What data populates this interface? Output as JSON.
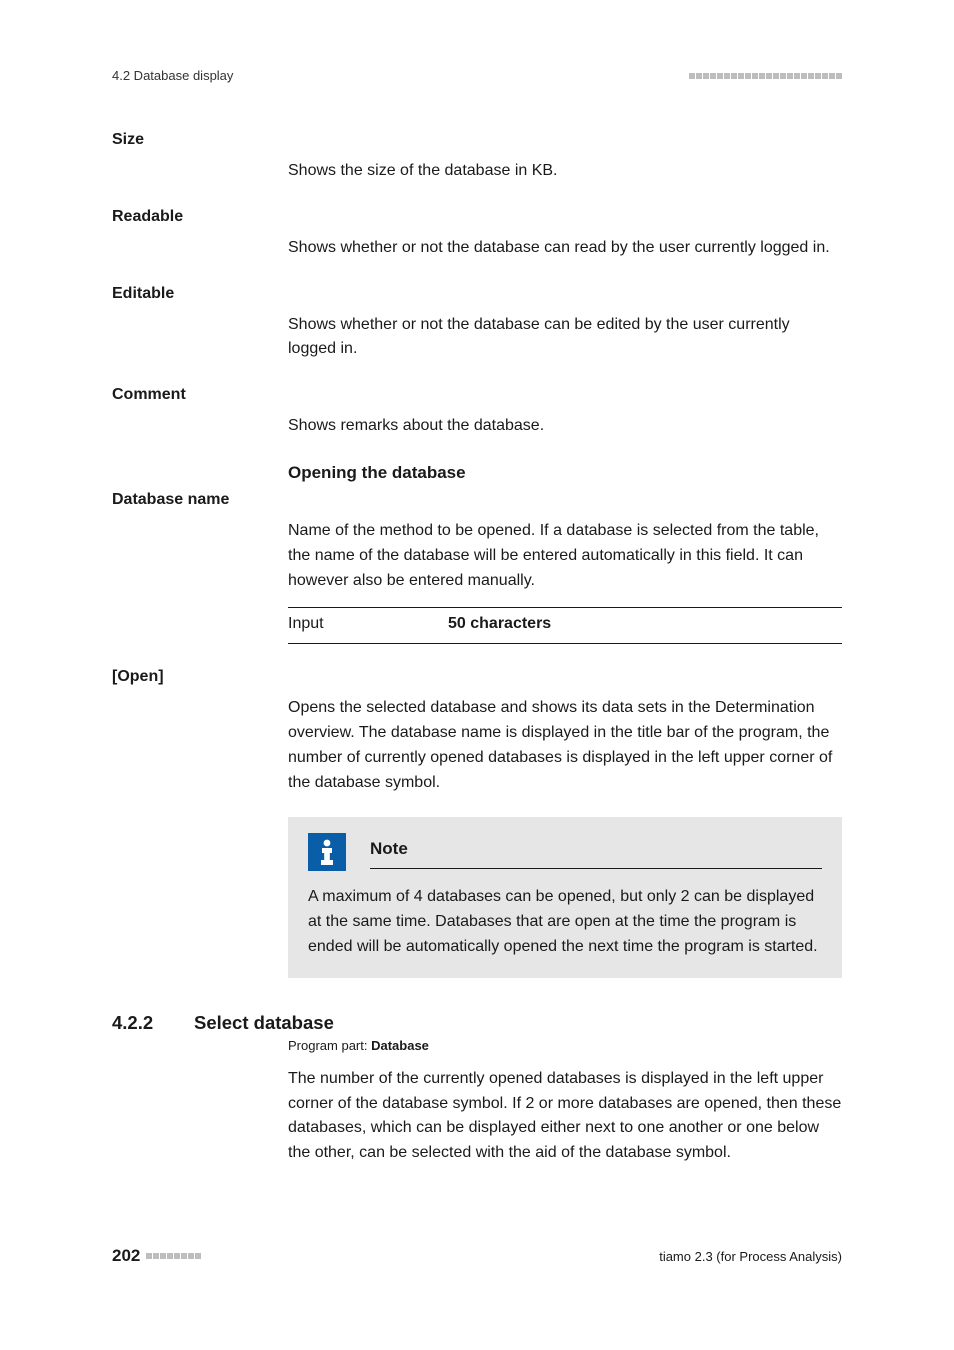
{
  "header": {
    "section_label": "4.2 Database display"
  },
  "fields": {
    "size": {
      "label": "Size",
      "body": "Shows the size of the database in KB."
    },
    "readable": {
      "label": "Readable",
      "body": "Shows whether or not the database can read by the user currently logged in."
    },
    "editable": {
      "label": "Editable",
      "body": "Shows whether or not the database can be edited by the user currently logged in."
    },
    "comment": {
      "label": "Comment",
      "body": "Shows remarks about the database."
    },
    "opening_heading": "Opening the database",
    "database_name": {
      "label": "Database name",
      "body": "Name of the method to be opened. If a database is selected from the table, the name of the database will be entered automatically in this field. It can however also be entered manually.",
      "input_label": "Input",
      "input_value": "50 characters"
    },
    "open": {
      "label": "[Open]",
      "body": "Opens the selected database and shows its data sets in the Determination overview. The database name is displayed in the title bar of the program, the number of currently opened databases is displayed in the left upper corner of the database symbol."
    }
  },
  "note": {
    "title": "Note",
    "body": "A maximum of 4 databases can be opened, but only 2 can be displayed at the same time. Databases that are open at the time the program is ended will be automatically opened the next time the program is started."
  },
  "section_4_2_2": {
    "number": "4.2.2",
    "title": "Select database",
    "program_part_label": "Program part: ",
    "program_part_value": "Database",
    "body": "The number of the currently opened databases is displayed in the left upper corner of the database symbol. If 2 or more databases are opened, then these databases, which can be displayed either next to one another or one below the other, can be selected with the aid of the database symbol."
  },
  "footer": {
    "page_number": "202",
    "product": "tiamo 2.3 (for Process Analysis)"
  }
}
